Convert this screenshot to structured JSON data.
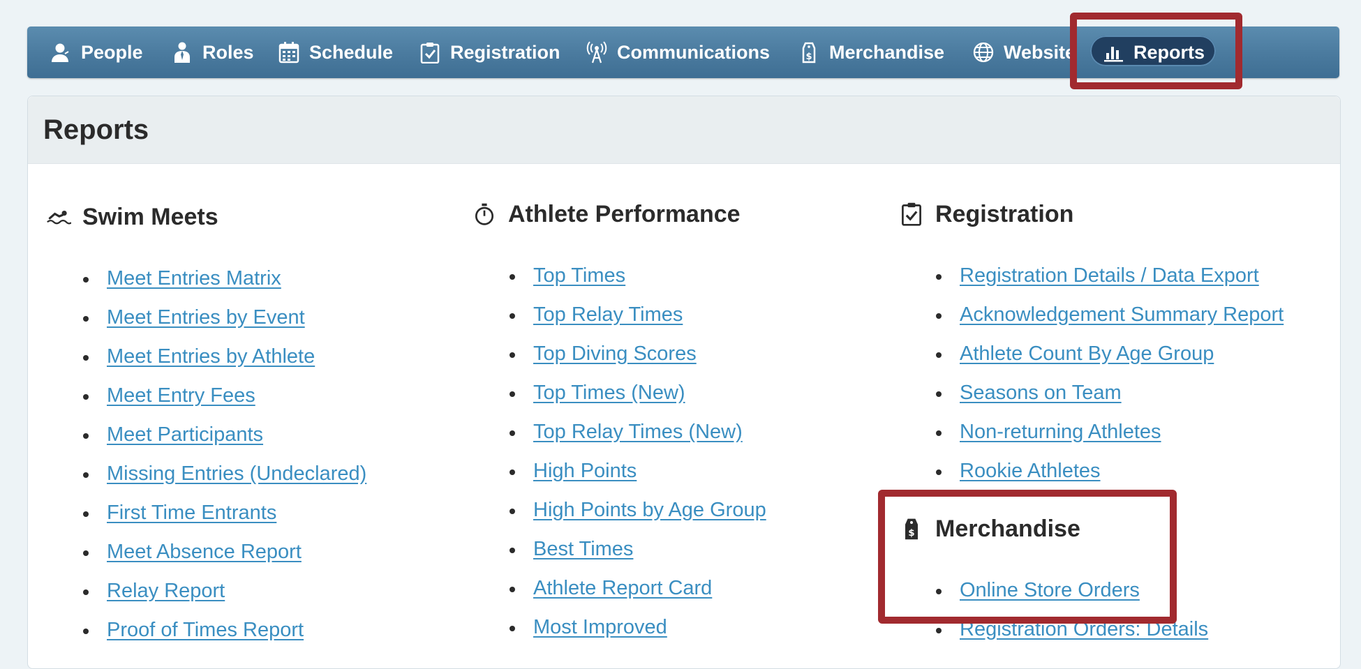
{
  "nav": {
    "items": [
      {
        "label": "People",
        "icon": "person-icon"
      },
      {
        "label": "Roles",
        "icon": "role-icon"
      },
      {
        "label": "Schedule",
        "icon": "calendar-icon"
      },
      {
        "label": "Registration",
        "icon": "clipboard-check-icon"
      },
      {
        "label": "Communications",
        "icon": "broadcast-tower-icon"
      },
      {
        "label": "Merchandise",
        "icon": "price-tag-icon"
      },
      {
        "label": "Website",
        "icon": "globe-icon"
      },
      {
        "label": "Reports",
        "icon": "bar-chart-icon"
      }
    ],
    "active": "Reports"
  },
  "page": {
    "title": "Reports"
  },
  "sections": {
    "swim_meets": {
      "title": "Swim Meets",
      "icon": "swimmer-icon",
      "links": [
        "Meet Entries Matrix",
        "Meet Entries by Event",
        "Meet Entries by Athlete",
        "Meet Entry Fees",
        "Meet Participants",
        "Missing Entries (Undeclared)",
        "First Time Entrants",
        "Meet Absence Report",
        "Relay Report",
        "Proof of Times Report"
      ]
    },
    "athlete_performance": {
      "title": "Athlete Performance",
      "icon": "stopwatch-icon",
      "links": [
        "Top Times",
        "Top Relay Times",
        "Top Diving Scores",
        "Top Times (New)",
        "Top Relay Times (New)",
        "High Points",
        "High Points by Age Group",
        "Best Times",
        "Athlete Report Card",
        "Most Improved"
      ]
    },
    "registration": {
      "title": "Registration",
      "icon": "clipboard-check-icon",
      "links": [
        "Registration Details / Data Export",
        "Acknowledgement Summary Report",
        "Athlete Count By Age Group",
        "Seasons on Team",
        "Non-returning Athletes",
        "Rookie Athletes"
      ]
    },
    "merchandise": {
      "title": "Merchandise",
      "icon": "price-tag-icon",
      "links": [
        "Online Store Orders",
        "Registration Orders: Details"
      ]
    }
  },
  "colors": {
    "highlight": "#a12a2f",
    "link": "#3a8ec1",
    "nav_active": "#213f60"
  }
}
